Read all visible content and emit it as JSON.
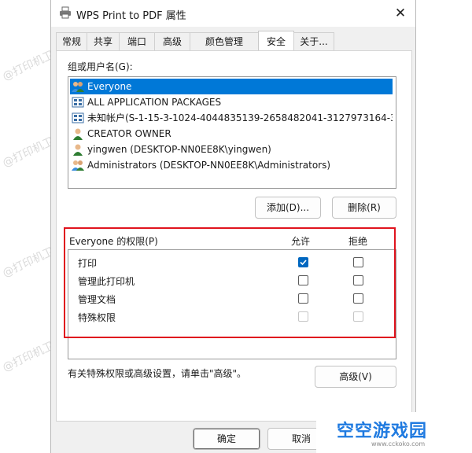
{
  "window": {
    "title": "WPS Print to PDF 属性",
    "close_symbol": "✕"
  },
  "tabs": [
    "常规",
    "共享",
    "端口",
    "高级",
    "颜色管理",
    "安全",
    "关于..."
  ],
  "active_tab": "安全",
  "groups": {
    "label": "组或用户名(G):",
    "items": [
      {
        "name": "Everyone",
        "icon": "users-icon",
        "selected": true
      },
      {
        "name": "ALL APPLICATION PACKAGES",
        "icon": "app-packages-icon",
        "selected": false
      },
      {
        "name": "未知帐户(S-1-15-3-1024-4044835139-2658482041-3127973164-32...",
        "icon": "unknown-account-icon",
        "selected": false
      },
      {
        "name": "CREATOR OWNER",
        "icon": "user-icon",
        "selected": false
      },
      {
        "name": "yingwen (DESKTOP-NN0EE8K\\yingwen)",
        "icon": "user-icon",
        "selected": false
      },
      {
        "name": "Administrators (DESKTOP-NN0EE8K\\Administrators)",
        "icon": "users-icon",
        "selected": false
      }
    ]
  },
  "buttons": {
    "add": "添加(D)...",
    "remove": "删除(R)",
    "advanced": "高级(V)",
    "ok": "确定",
    "cancel": "取消"
  },
  "permissions": {
    "title": "Everyone 的权限(P)",
    "allow_header": "允许",
    "deny_header": "拒绝",
    "rows": [
      {
        "name": "打印",
        "allow": true,
        "deny": false,
        "disabled": false
      },
      {
        "name": "管理此打印机",
        "allow": false,
        "deny": false,
        "disabled": false
      },
      {
        "name": "管理文档",
        "allow": false,
        "deny": false,
        "disabled": false
      },
      {
        "name": "特殊权限",
        "allow": false,
        "deny": false,
        "disabled": true
      }
    ]
  },
  "advanced_hint": "有关特殊权限或高级设置，请单击\"高级\"。",
  "watermark": {
    "text": "@打印机卫士"
  },
  "logo": {
    "text": "空空游戏园",
    "url": "www.cckoko.com"
  },
  "colors": {
    "accent": "#0078d7",
    "highlight_box": "#e0141e",
    "logo_blue": "#1f7ae0"
  }
}
